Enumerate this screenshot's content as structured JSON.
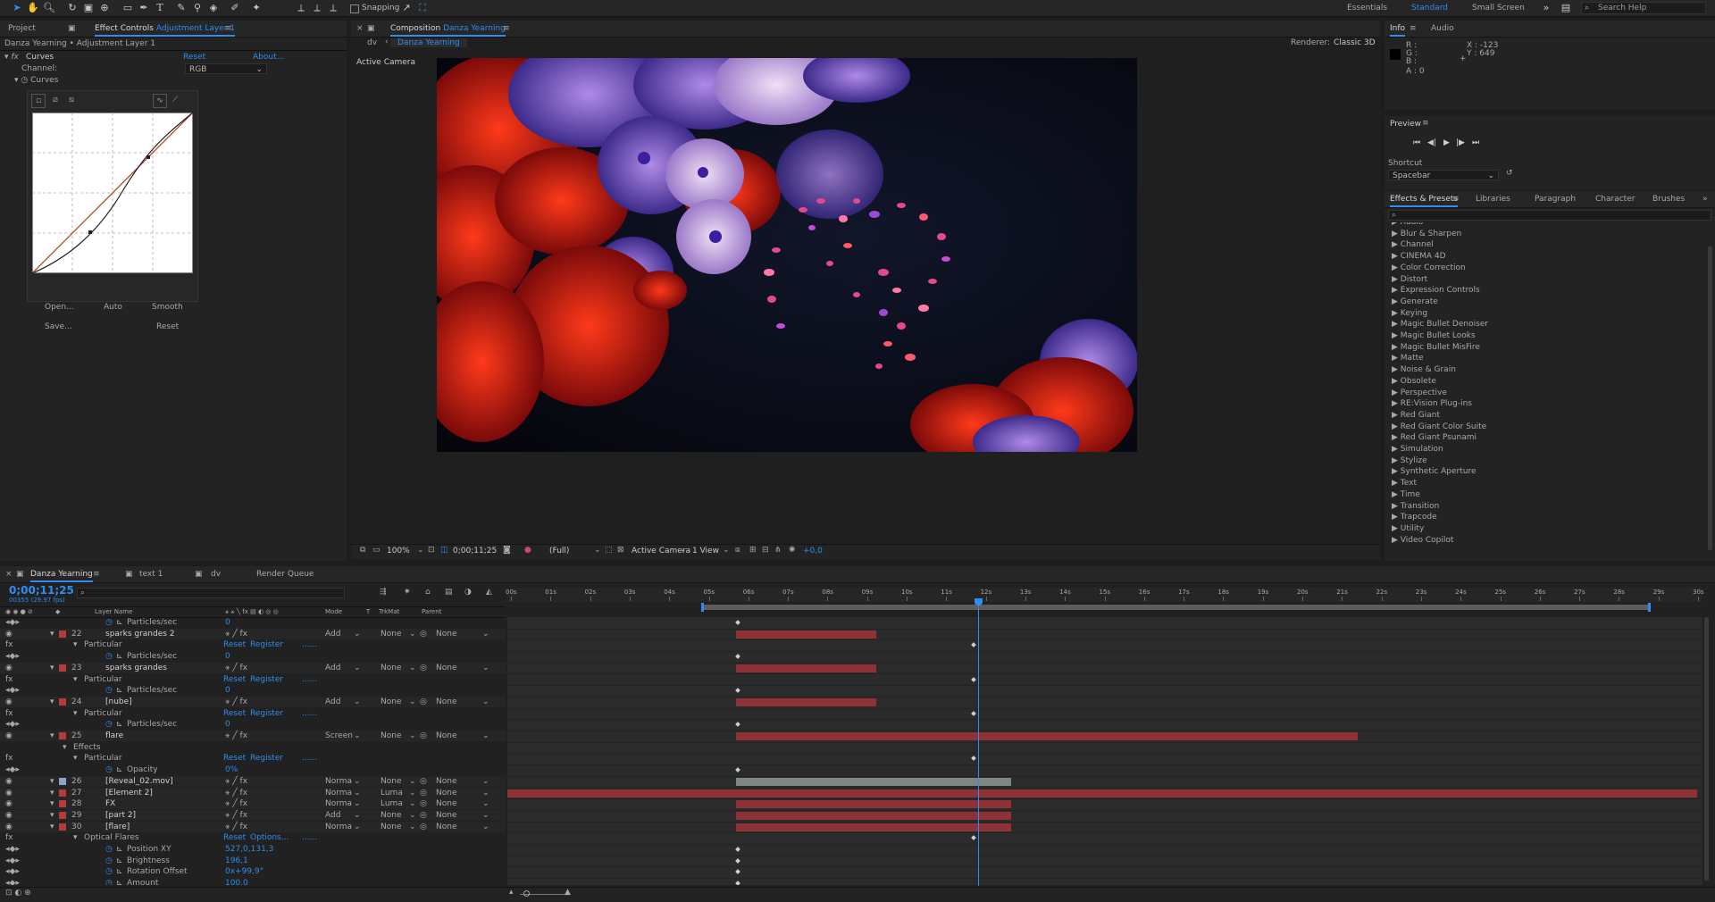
{
  "toolbar": {
    "snapping_label": "Snapping",
    "workspaces": [
      "Essentials",
      "Standard",
      "Small Screen"
    ],
    "search_placeholder": "Search Help"
  },
  "left_panel": {
    "tab_project": "Project",
    "tab_effect_controls": "Effect Controls",
    "tab_effect_target": "Adjustment Layer 1",
    "breadcrumb": "Danza Yearning • Adjustment Layer 1",
    "effect_name": "Curves",
    "reset_label": "Reset",
    "about_label": "About...",
    "channel_label": "Channel:",
    "channel_value": "RGB",
    "curves_label": "Curves",
    "buttons": {
      "open": "Open...",
      "auto": "Auto",
      "smooth": "Smooth",
      "save": "Save...",
      "reset": "Reset"
    }
  },
  "comp_panel": {
    "tab_prefix": "Composition",
    "tab_name": "Danza Yearning",
    "crumb_dv": "dv",
    "crumb_active": "Danza Yearning",
    "renderer_label": "Renderer:",
    "renderer_value": "Classic 3D",
    "view_label": "Active Camera",
    "footer": {
      "zoom": "100%",
      "timecode": "0;00;11;25",
      "resolution": "(Full)",
      "camera": "Active Camera",
      "views": "1 View",
      "exposure": "+0,0"
    }
  },
  "info_panel": {
    "tab_info": "Info",
    "tab_audio": "Audio",
    "r": "R :",
    "g": "G :",
    "b": "B :",
    "a": "A : 0",
    "x": "X : -123",
    "y": "Y : 649"
  },
  "preview_panel": {
    "title": "Preview",
    "shortcut_label": "Shortcut",
    "shortcut_value": "Spacebar"
  },
  "effects_panel": {
    "tabs": [
      "Effects & Presets",
      "Libraries",
      "Paragraph",
      "Character",
      "Brushes"
    ],
    "items": [
      "Audio",
      "Blur & Sharpen",
      "Channel",
      "CINEMA 4D",
      "Color Correction",
      "Distort",
      "Expression Controls",
      "Generate",
      "Keying",
      "Magic Bullet Denoiser",
      "Magic Bullet Looks",
      "Magic Bullet MisFire",
      "Matte",
      "Noise & Grain",
      "Obsolete",
      "Perspective",
      "RE:Vision Plug-ins",
      "Red Giant",
      "Red Giant Color Suite",
      "Red Giant Psunami",
      "Simulation",
      "Stylize",
      "Synthetic Aperture",
      "Text",
      "Time",
      "Transition",
      "Trapcode",
      "Utility",
      "Video Copilot"
    ]
  },
  "timeline": {
    "tabs": [
      "Danza Yearning",
      "text 1",
      "dv",
      "Render Queue"
    ],
    "timecode": "0;00;11;25",
    "frame_info": "00355 (29.97 fps)",
    "columns": {
      "layer_name": "Layer Name",
      "mode": "Mode",
      "t": "T",
      "trkmat": "TrkMat",
      "parent": "Parent"
    },
    "ruler": [
      "00s",
      "01s",
      "02s",
      "03s",
      "04s",
      "05s",
      "06s",
      "07s",
      "08s",
      "09s",
      "10s",
      "11s",
      "12s",
      "13s",
      "14s",
      "15s",
      "16s",
      "17s",
      "18s",
      "19s",
      "20s",
      "21s",
      "22s",
      "23s",
      "24s",
      "25s",
      "26s",
      "27s",
      "28s",
      "29s",
      "30s"
    ],
    "rows": [
      {
        "num": "",
        "name": "Particles/sec",
        "kind": "prop",
        "value": "0"
      },
      {
        "num": "22",
        "name": "sparks grandes 2",
        "kind": "layer",
        "mode": "Add",
        "trk": "None",
        "parent": "None"
      },
      {
        "num": "",
        "name": "Particular",
        "kind": "effect",
        "reset": "Reset",
        "register": "Register",
        "dots": "......"
      },
      {
        "num": "",
        "name": "Particles/sec",
        "kind": "prop",
        "value": "0"
      },
      {
        "num": "23",
        "name": "sparks grandes",
        "kind": "layer",
        "mode": "Add",
        "trk": "None",
        "parent": "None"
      },
      {
        "num": "",
        "name": "Particular",
        "kind": "effect",
        "reset": "Reset",
        "register": "Register",
        "dots": "......"
      },
      {
        "num": "",
        "name": "Particles/sec",
        "kind": "prop",
        "value": "0"
      },
      {
        "num": "24",
        "name": "[nube]",
        "kind": "layer",
        "mode": "Add",
        "trk": "None",
        "parent": "None"
      },
      {
        "num": "",
        "name": "Particular",
        "kind": "effect",
        "reset": "Reset",
        "register": "Register",
        "dots": "......"
      },
      {
        "num": "",
        "name": "Particles/sec",
        "kind": "prop",
        "value": "0"
      },
      {
        "num": "25",
        "name": "flare",
        "kind": "layer",
        "mode": "Screen",
        "trk": "None",
        "parent": "None"
      },
      {
        "num": "",
        "name": "Effects",
        "kind": "group"
      },
      {
        "num": "",
        "name": "Particular",
        "kind": "effect",
        "reset": "Reset",
        "register": "Register",
        "dots": "......"
      },
      {
        "num": "",
        "name": "Opacity",
        "kind": "prop",
        "value": "0%"
      },
      {
        "num": "26",
        "name": "[Reveal_02.mov]",
        "kind": "layer",
        "mode": "Norma",
        "trk": "None",
        "parent": "None"
      },
      {
        "num": "27",
        "name": "[Element 2]",
        "kind": "layer",
        "mode": "Norma",
        "trk": "Luma",
        "parent": "None"
      },
      {
        "num": "28",
        "name": "FX",
        "kind": "layer",
        "mode": "Norma",
        "trk": "Luma",
        "parent": "None"
      },
      {
        "num": "29",
        "name": "[part 2]",
        "kind": "layer",
        "mode": "Add",
        "trk": "None",
        "parent": "None"
      },
      {
        "num": "30",
        "name": "[flare]",
        "kind": "layer",
        "mode": "Norma",
        "trk": "None",
        "parent": "None"
      },
      {
        "num": "",
        "name": "Optical Flares",
        "kind": "effect",
        "reset": "Reset",
        "register": "Options...",
        "dots": "......"
      },
      {
        "num": "",
        "name": "Position XY",
        "kind": "prop",
        "value": "527,0,131,3"
      },
      {
        "num": "",
        "name": "Brightness",
        "kind": "prop",
        "value": "196,1"
      },
      {
        "num": "",
        "name": "Rotation Offset",
        "kind": "prop",
        "value": "0x+99,9°"
      },
      {
        "num": "",
        "name": "Amount",
        "kind": "prop",
        "value": "100,0"
      }
    ]
  },
  "colors": {
    "accent": "#2f8cf0",
    "layer_red": "#b33b3b",
    "bar_red": "#8e3237",
    "bar_gray": "#7d8585"
  }
}
